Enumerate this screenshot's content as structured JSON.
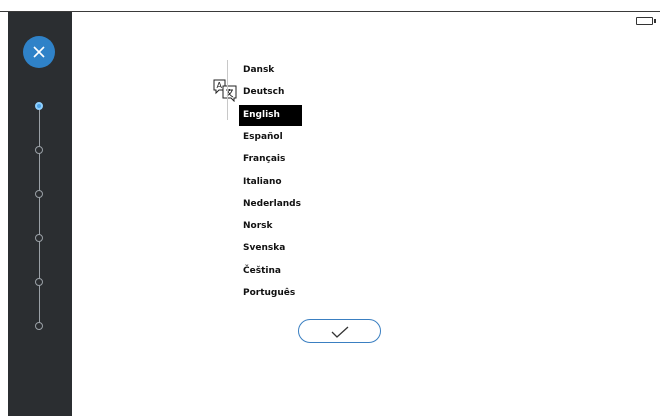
{
  "wizard": {
    "close_icon": "close-icon",
    "steps": [
      {
        "state": "current"
      },
      {
        "state": "todo"
      },
      {
        "state": "todo"
      },
      {
        "state": "todo"
      },
      {
        "state": "todo"
      },
      {
        "state": "todo"
      }
    ]
  },
  "status": {
    "battery_icon": "battery-icon"
  },
  "language": {
    "icon": "translate-icon",
    "selected": "English",
    "options": [
      "Dansk",
      "Deutsch",
      "English",
      "Español",
      "Français",
      "Italiano",
      "Nederlands",
      "Norsk",
      "Svenska",
      "Čeština",
      "Português"
    ]
  },
  "confirm": {
    "icon": "checkmark-icon"
  },
  "colors": {
    "accent": "#2f82c8",
    "sidebar": "#2b2e31",
    "selected_bg": "#000000"
  }
}
